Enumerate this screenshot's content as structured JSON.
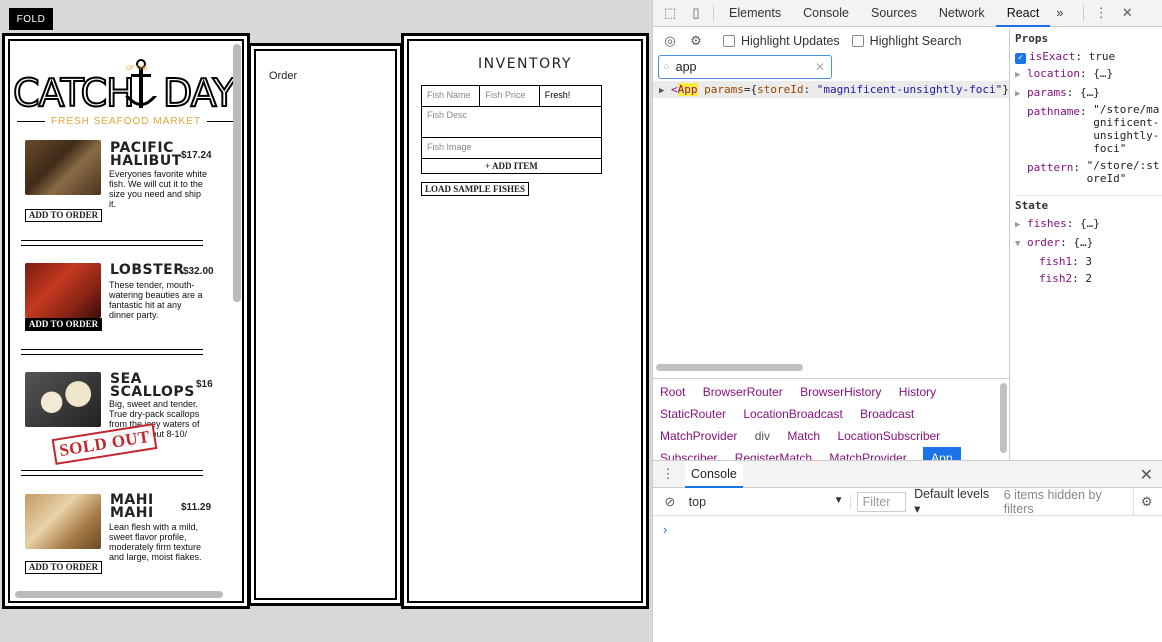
{
  "fold_label": "FOLD",
  "menu": {
    "logo_left": "CATCH",
    "logo_middle": "OF THE",
    "logo_right": "DAY",
    "tagline": "FRESH SEAFOOD MARKET",
    "fishes": [
      {
        "name": "Pacific Halibut",
        "price": "$17.24",
        "desc": "Everyones favorite white fish. We will cut it to the size you need and ship it.",
        "button": "ADD TO ORDER",
        "status": "available"
      },
      {
        "name": "Lobster",
        "price": "$32.00",
        "desc": "These tender, mouth-watering beauties are a fantastic hit at any dinner party.",
        "button": "ADD TO ORDER",
        "status": "available"
      },
      {
        "name": "Sea Scallops",
        "price": "$16",
        "desc": "Big, sweet and tender. True dry-pack scallops from the icey waters of Alaska. About 8-10/ pound",
        "button": "SOLD OUT",
        "status": "sold-out"
      },
      {
        "name": "Mahi Mahi",
        "price": "$11.29",
        "desc": "Lean flesh with a mild, sweet flavor profile, moderately firm texture and large, moist flakes.",
        "button": "ADD TO ORDER",
        "status": "available"
      }
    ]
  },
  "order": {
    "label": "Order"
  },
  "inventory": {
    "title": "INVENTORY",
    "name_placeholder": "Fish Name",
    "price_placeholder": "Fish Price",
    "status_value": "Fresh!",
    "desc_placeholder": "Fish Desc",
    "image_placeholder": "Fish Image",
    "add_button": "+ ADD ITEM",
    "load_button": "LOAD SAMPLE FISHES"
  },
  "devtools": {
    "tabs": [
      "Elements",
      "Console",
      "Sources",
      "Network",
      "React"
    ],
    "active_tab": "React",
    "more": "»",
    "highlight_updates": "Highlight Updates",
    "highlight_search": "Highlight Search",
    "search_value": "app",
    "tree": {
      "component": "App",
      "prop": "params",
      "value": "storeId",
      "str": "\"magnificent-unsightly-foci\""
    },
    "breadcrumbs": [
      "Root",
      "BrowserRouter",
      "BrowserHistory",
      "History",
      "StaticRouter",
      "LocationBroadcast",
      "Broadcast",
      "MatchProvider",
      "div",
      "Match",
      "LocationSubscriber",
      "Subscriber",
      "RegisterMatch",
      "MatchProvider",
      "App"
    ],
    "props_title": "Props",
    "props": [
      {
        "key": "isExact",
        "value": "true"
      },
      {
        "key": "location",
        "value": "{…}"
      },
      {
        "key": "params",
        "value": "{…}"
      },
      {
        "key": "pathname",
        "value": "\"/store/magnificent-unsightly-foci\""
      },
      {
        "key": "pattern",
        "value": "\"/store/:storeId\""
      }
    ],
    "state_title": "State",
    "state": [
      {
        "key": "fishes",
        "value": "{…}"
      },
      {
        "key": "order",
        "value": "{…}"
      }
    ],
    "order_items": [
      {
        "key": "fish1",
        "value": "3"
      },
      {
        "key": "fish2",
        "value": "2"
      }
    ],
    "console": {
      "tab": "Console",
      "context": "top",
      "filter_placeholder": "Filter",
      "levels": "Default levels ▾",
      "hidden": "6 items hidden by filters",
      "prompt": "›"
    }
  },
  "colors": {
    "accent": "#1a73e8",
    "tagline": "#e8a33a",
    "sold_out": "#c0272d"
  }
}
